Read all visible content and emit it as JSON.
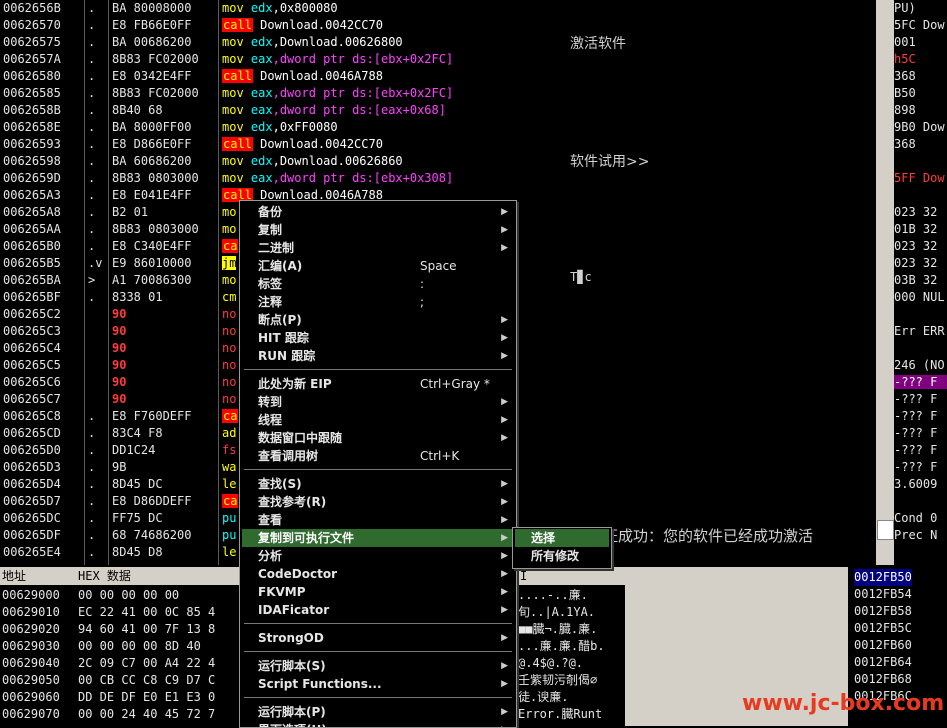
{
  "disasm_rows": [
    {
      "addr": "0062656B",
      "mark": ".",
      "hex": "BA 80008000",
      "asm": [
        {
          "t": "mov",
          "c": "mn"
        },
        {
          "t": " edx",
          "c": "reg"
        },
        {
          "t": ",0x800080"
        }
      ]
    },
    {
      "addr": "00626570",
      "mark": ".",
      "hex": "E8 FB66E0FF",
      "asm": [
        {
          "t": "call",
          "c": "callb"
        },
        {
          "t": " Download.0042CC70"
        }
      ]
    },
    {
      "addr": "00626575",
      "mark": ".",
      "hex": "BA 00686200",
      "asm": [
        {
          "t": "mov",
          "c": "mn"
        },
        {
          "t": " edx",
          "c": "reg"
        },
        {
          "t": ",Download.00626800"
        }
      ]
    },
    {
      "addr": "0062657A",
      "mark": ".",
      "hex": "8B83 FC02000",
      "asm": [
        {
          "t": "mov",
          "c": "mn"
        },
        {
          "t": " eax",
          "c": "reg"
        },
        {
          "t": ",dword ptr ds:[ebx+0x2FC]",
          "c": "mem"
        }
      ]
    },
    {
      "addr": "00626580",
      "mark": ".",
      "hex": "E8 0342E4FF",
      "asm": [
        {
          "t": "call",
          "c": "callb"
        },
        {
          "t": " Download.0046A788"
        }
      ]
    },
    {
      "addr": "00626585",
      "mark": ".",
      "hex": "8B83 FC02000",
      "asm": [
        {
          "t": "mov",
          "c": "mn"
        },
        {
          "t": " eax",
          "c": "reg"
        },
        {
          "t": ",dword ptr ds:[ebx+0x2FC]",
          "c": "mem"
        }
      ]
    },
    {
      "addr": "0062658B",
      "mark": ".",
      "hex": "8B40 68",
      "asm": [
        {
          "t": "mov",
          "c": "mn"
        },
        {
          "t": " eax",
          "c": "reg"
        },
        {
          "t": ",dword ptr ds:[eax+0x68]",
          "c": "mem"
        }
      ]
    },
    {
      "addr": "0062658E",
      "mark": ".",
      "hex": "BA 8000FF00",
      "asm": [
        {
          "t": "mov",
          "c": "mn"
        },
        {
          "t": " edx",
          "c": "reg"
        },
        {
          "t": ",0xFF0080"
        }
      ]
    },
    {
      "addr": "00626593",
      "mark": ".",
      "hex": "E8 D866E0FF",
      "asm": [
        {
          "t": "call",
          "c": "callb"
        },
        {
          "t": " Download.0042CC70"
        }
      ]
    },
    {
      "addr": "00626598",
      "mark": ".",
      "hex": "BA 60686200",
      "asm": [
        {
          "t": "mov",
          "c": "mn"
        },
        {
          "t": " edx",
          "c": "reg"
        },
        {
          "t": ",Download.00626860"
        }
      ]
    },
    {
      "addr": "0062659D",
      "mark": ".",
      "hex": "8B83 0803000",
      "asm": [
        {
          "t": "mov",
          "c": "mn"
        },
        {
          "t": " eax",
          "c": "reg"
        },
        {
          "t": ",dword ptr ds:[ebx+0x308]",
          "c": "mem"
        }
      ]
    },
    {
      "addr": "006265A3",
      "mark": ".",
      "hex": "E8 E041E4FF",
      "asm": [
        {
          "t": "call",
          "c": "callb"
        },
        {
          "t": " Download.0046A788"
        }
      ]
    },
    {
      "addr": "006265A8",
      "mark": ".",
      "hex": "B2 01",
      "asm": [
        {
          "t": "mo",
          "c": "mn"
        }
      ]
    },
    {
      "addr": "006265AA",
      "mark": ".",
      "hex": "8B83 0803000",
      "asm": [
        {
          "t": "mo",
          "c": "mn"
        }
      ]
    },
    {
      "addr": "006265B0",
      "mark": ".",
      "hex": "E8 C340E4FF",
      "asm": [
        {
          "t": "ca",
          "c": "callb"
        }
      ]
    },
    {
      "addr": "006265B5",
      "mark": ".v",
      "hex": "E9 86010000",
      "asm": [
        {
          "t": "jm",
          "c": "jmpb"
        }
      ]
    },
    {
      "addr": "006265BA",
      "mark": ">",
      "hex": "A1 70086300",
      "asm": [
        {
          "t": "mo",
          "c": "mn"
        }
      ]
    },
    {
      "addr": "006265BF",
      "mark": ".",
      "hex": "8338 01",
      "asm": [
        {
          "t": "cm",
          "c": "mn"
        }
      ]
    },
    {
      "addr": "006265C2",
      "mark": "",
      "hex": "90",
      "red": true,
      "asm": [
        {
          "t": "no",
          "c": "red"
        }
      ]
    },
    {
      "addr": "006265C3",
      "mark": "",
      "hex": "90",
      "red": true,
      "asm": [
        {
          "t": "no",
          "c": "red"
        }
      ]
    },
    {
      "addr": "006265C4",
      "mark": "",
      "hex": "90",
      "red": true,
      "asm": [
        {
          "t": "no",
          "c": "red"
        }
      ]
    },
    {
      "addr": "006265C5",
      "mark": "",
      "hex": "90",
      "red": true,
      "asm": [
        {
          "t": "no",
          "c": "red"
        }
      ]
    },
    {
      "addr": "006265C6",
      "mark": "",
      "hex": "90",
      "red": true,
      "asm": [
        {
          "t": "no",
          "c": "red"
        }
      ]
    },
    {
      "addr": "006265C7",
      "mark": "",
      "hex": "90",
      "red": true,
      "asm": [
        {
          "t": "no",
          "c": "red"
        }
      ]
    },
    {
      "addr": "006265C8",
      "mark": ".",
      "hex": "E8 F760DEFF",
      "asm": [
        {
          "t": "ca",
          "c": "callb"
        }
      ]
    },
    {
      "addr": "006265CD",
      "mark": ".",
      "hex": "83C4 F8",
      "asm": [
        {
          "t": "ad",
          "c": "mn"
        }
      ]
    },
    {
      "addr": "006265D0",
      "mark": ".",
      "hex": "DD1C24",
      "asm": [
        {
          "t": "fs",
          "c": "red"
        }
      ]
    },
    {
      "addr": "006265D3",
      "mark": ".",
      "hex": "9B",
      "asm": [
        {
          "t": "wa",
          "c": "mn"
        }
      ]
    },
    {
      "addr": "006265D4",
      "mark": ".",
      "hex": "8D45 DC",
      "asm": [
        {
          "t": "le",
          "c": "mn"
        }
      ]
    },
    {
      "addr": "006265D7",
      "mark": ".",
      "hex": "E8 D86DDEFF",
      "asm": [
        {
          "t": "ca",
          "c": "callb"
        }
      ]
    },
    {
      "addr": "006265DC",
      "mark": ".",
      "hex": "FF75 DC",
      "asm": [
        {
          "t": "pu",
          "c": "reg"
        }
      ]
    },
    {
      "addr": "006265DF",
      "mark": ".",
      "hex": "68 74686200",
      "asm": [
        {
          "t": "pu",
          "c": "reg"
        }
      ]
    },
    {
      "addr": "006265E4",
      "mark": ".",
      "hex": "8D45 D8",
      "asm": [
        {
          "t": "le",
          "c": "mn"
        }
      ]
    }
  ],
  "info": {
    "t1": "激活软件",
    "t2": "软件试用>>",
    "t3": "T▊c",
    "t4": "注册验证成功：您的软件已经成功激活"
  },
  "regs": [
    {
      "t": "PU)",
      "hl": false
    },
    {
      "t": "5FC Dow",
      "hl": false
    },
    {
      "t": "001",
      "hl": false
    },
    {
      "t": "h5C",
      "red": true
    },
    {
      "t": "368",
      "hl": false
    },
    {
      "t": "B50",
      "hl": false
    },
    {
      "t": "898",
      "hl": false
    },
    {
      "t": "9B0 Dow",
      "hl": false
    },
    {
      "t": "368",
      "hl": false
    },
    {
      "t": "",
      "hl": false
    },
    {
      "t": "5FF Dow",
      "red": true
    },
    {
      "t": "",
      "hl": false
    },
    {
      "t": "023 32",
      "hl": false
    },
    {
      "t": "01B 32",
      "hl": false
    },
    {
      "t": "023 32",
      "hl": false
    },
    {
      "t": "023 32",
      "hl": false
    },
    {
      "t": "03B 32",
      "hl": false
    },
    {
      "t": "000 NUL",
      "hl": false
    },
    {
      "t": "",
      "hl": false
    },
    {
      "t": "Err ERR",
      "hl": false
    },
    {
      "t": "",
      "hl": false
    },
    {
      "t": "246 (NO",
      "hl": false
    },
    {
      "t": "-??? F",
      "hl": true
    },
    {
      "t": "-??? F",
      "hl": false
    },
    {
      "t": "-??? F",
      "hl": false
    },
    {
      "t": "-??? F",
      "hl": false
    },
    {
      "t": "-??? F",
      "hl": false
    },
    {
      "t": "-??? F",
      "hl": false
    },
    {
      "t": "3.6009",
      "hl": false
    },
    {
      "t": "",
      "hl": false
    },
    {
      "t": "Cond 0",
      "hl": false
    },
    {
      "t": "Prec N",
      "hl": false
    }
  ],
  "dump": {
    "col_addr": "地址",
    "col_hex": "HEX 数据",
    "col_ascii": "I",
    "rows": [
      {
        "a": "00629000",
        "h": "00 00 00 00 00",
        "s": "....-..亷."
      },
      {
        "a": "00629010",
        "h": "EC 22 41 00 0C 85 4",
        "s": "旬..|A.1YA."
      },
      {
        "a": "00629020",
        "h": "94 60 41 00 7F 13 8",
        "s": "■■臓¬.臓.亷."
      },
      {
        "a": "00629030",
        "h": "00 00 00 00 8D 40",
        "s": "...亷.亷.醋b."
      },
      {
        "a": "00629040",
        "h": "2C 09 C7 00 A4 22 4",
        "s": "@.4$@.?@."
      },
      {
        "a": "00629050",
        "h": "00 CB CC C8 C9 D7 C",
        "s": "壬紫韧污剞偈∅"
      },
      {
        "a": "00629060",
        "h": "DD DE DF E0 E1 E3 0",
        "s": "徒.谀亷."
      },
      {
        "a": "00629070",
        "h": "00 00 24 40 45 72 7",
        "s": "Error.臓Runt"
      }
    ]
  },
  "stack": [
    {
      "t": "0012FB50",
      "hl": true
    },
    {
      "t": "0012FB54",
      "hl": false
    },
    {
      "t": "0012FB58",
      "hl": false
    },
    {
      "t": "0012FB5C",
      "hl": false
    },
    {
      "t": "0012FB60",
      "hl": false
    },
    {
      "t": "0012FB64",
      "hl": false
    },
    {
      "t": "0012FB68",
      "hl": false
    },
    {
      "t": "0012FB6C",
      "hl": false
    }
  ],
  "context_menu": {
    "items": [
      {
        "label": "备份",
        "arrow": true
      },
      {
        "label": "复制",
        "arrow": true
      },
      {
        "label": "二进制",
        "arrow": true
      },
      {
        "label": "汇编(A)",
        "shortcut": "Space"
      },
      {
        "label": "标签",
        "shortcut": ":"
      },
      {
        "label": "注释",
        "shortcut": ";"
      },
      {
        "label": "断点(P)",
        "arrow": true
      },
      {
        "label": "HIT 跟踪",
        "arrow": true
      },
      {
        "label": "RUN 跟踪",
        "arrow": true
      },
      {
        "sep": true
      },
      {
        "label": "此处为新 EIP",
        "shortcut": "Ctrl+Gray *"
      },
      {
        "label": "转到",
        "arrow": true
      },
      {
        "label": "线程",
        "arrow": true
      },
      {
        "label": "数据窗口中跟随",
        "arrow": true
      },
      {
        "label": "查看调用树",
        "shortcut": "Ctrl+K"
      },
      {
        "sep": true
      },
      {
        "label": "查找(S)",
        "arrow": true
      },
      {
        "label": "查找参考(R)",
        "arrow": true
      },
      {
        "label": "查看",
        "arrow": true
      },
      {
        "label": "复制到可执行文件",
        "arrow": true,
        "selected": true
      },
      {
        "label": "分析",
        "arrow": true
      },
      {
        "label": "CodeDoctor",
        "arrow": true
      },
      {
        "label": "FKVMP",
        "arrow": true
      },
      {
        "label": "IDAFicator",
        "arrow": true
      },
      {
        "sep": true
      },
      {
        "label": "StrongOD",
        "arrow": true
      },
      {
        "sep": true
      },
      {
        "label": "运行脚本(S)",
        "arrow": true
      },
      {
        "label": "Script Functions...",
        "arrow": true
      },
      {
        "sep": true
      },
      {
        "label": "运行脚本(P)",
        "arrow": true
      },
      {
        "label": "界面选项(U)",
        "arrow": true
      }
    ]
  },
  "submenu": {
    "items": [
      {
        "label": "选择",
        "selected": true
      },
      {
        "label": "所有修改"
      }
    ]
  },
  "watermark": "www.jc-box.com"
}
